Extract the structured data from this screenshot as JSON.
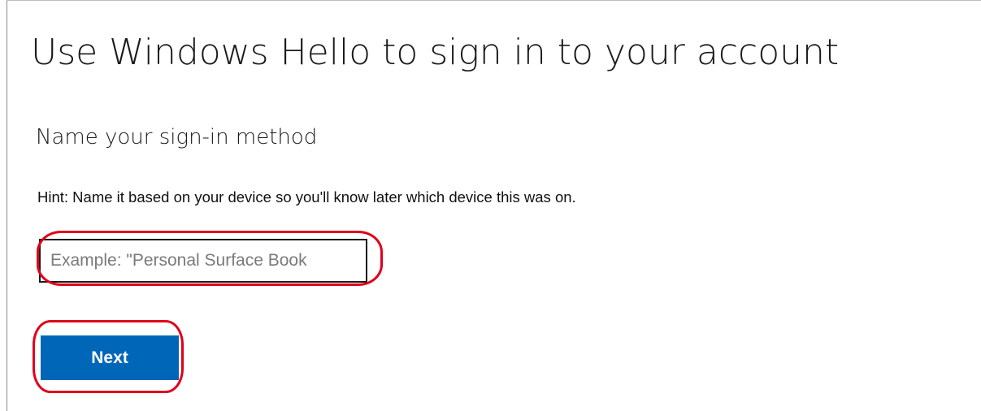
{
  "page": {
    "title": "Use Windows Hello to sign in to your account",
    "subtitle": "Name your sign-in method",
    "hint": "Hint: Name it based on your device so you'll know later which device this was on."
  },
  "form": {
    "name_input": {
      "value": "",
      "placeholder": "Example: \"Personal Surface Book"
    },
    "next_label": "Next"
  },
  "colors": {
    "button_background": "#0067b8",
    "button_text": "#ffffff",
    "annotation_outline": "#e0001b",
    "input_border": "#1a1a1a",
    "placeholder_text": "#7a7a7a"
  }
}
